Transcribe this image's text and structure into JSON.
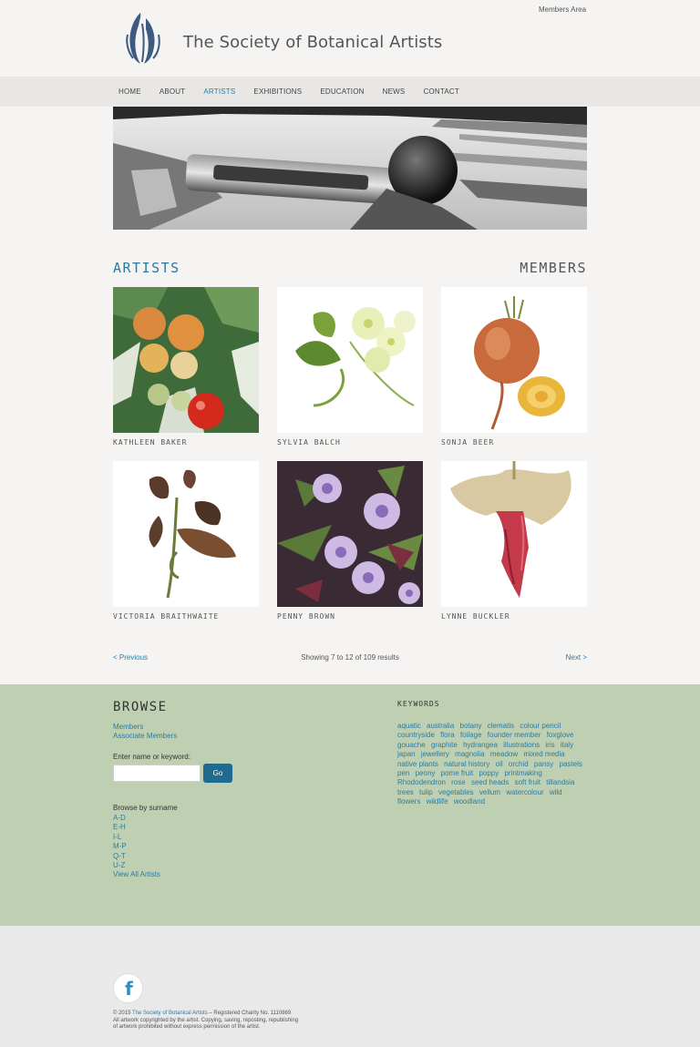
{
  "header": {
    "members_area": "Members Area",
    "site_title": "The Society of Botanical Artists"
  },
  "nav": {
    "items": [
      "HOME",
      "ABOUT",
      "ARTISTS",
      "EXHIBITIONS",
      "EDUCATION",
      "NEWS",
      "CONTACT"
    ],
    "active": "ARTISTS"
  },
  "sections": {
    "artists": "ARTISTS",
    "members": "MEMBERS"
  },
  "artists": [
    {
      "name": "KATHLEEN BAKER"
    },
    {
      "name": "SYLVIA BALCH"
    },
    {
      "name": "SONJA BEER"
    },
    {
      "name": "VICTORIA BRAITHWAITE"
    },
    {
      "name": "PENNY BROWN"
    },
    {
      "name": "LYNNE BUCKLER"
    }
  ],
  "pager": {
    "previous": "< Previous",
    "count": "Showing 7 to 12 of 109 results",
    "next": "Next >"
  },
  "browse": {
    "title": "BROWSE",
    "links": [
      "Members",
      "Associate Members"
    ],
    "keyword_label": "Enter name or keyword:",
    "keyword_value": "",
    "go_label": "Go",
    "surname_label": "Browse by surname",
    "surname_links": [
      "A-D",
      "E-H",
      "I-L",
      "M-P",
      "Q-T",
      "U-Z",
      "View All Artists"
    ]
  },
  "keywords": {
    "title": "KEYWORDS",
    "items": [
      "aquatic",
      "australia",
      "botany",
      "clematis",
      "colour pencil",
      "countryside",
      "flora",
      "foilage",
      "founder member",
      "foxglove",
      "gouache",
      "graphite",
      "hydrangea",
      "illustrations",
      "iris",
      "italy",
      "japan",
      "jewellery",
      "magnolia",
      "meadow",
      "mixed media",
      "native plants",
      "natural history",
      "oil",
      "orchid",
      "pansy",
      "pastels",
      "pen",
      "peony",
      "pome fruit",
      "poppy",
      "printmaking",
      "Rhododendron",
      "rose",
      "seed heads",
      "soft fruit",
      "tillandsia",
      "trees",
      "tulip",
      "vegetables",
      "vellum",
      "watercolour",
      "wild",
      "flowers",
      "wildlife",
      "woodland"
    ]
  },
  "footer": {
    "facebook_letter": "f",
    "copyright_prefix": "© 2015 ",
    "society_link": "The Society of Botanical Artists",
    "charity": " – Registered Charity No. 1110869",
    "line2": "All artwork copyrighted by the artist. Copying, saving, reposting, republishing",
    "line3": "of artwork prohibited without express permission of the artist."
  },
  "colors": {
    "accent": "#2a7ba4",
    "browse_bg": "#bfd0b2",
    "go_button": "#1f6a8e"
  }
}
